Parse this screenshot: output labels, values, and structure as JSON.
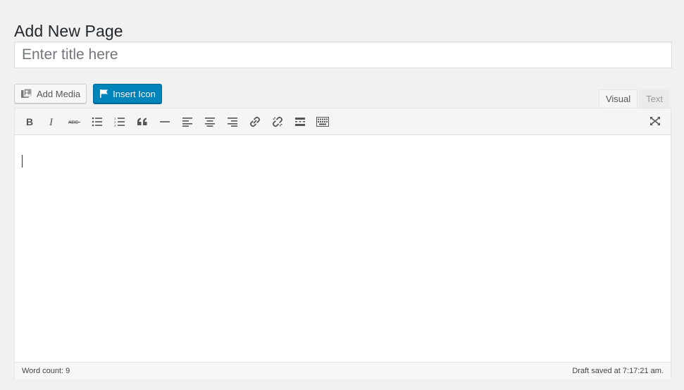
{
  "page": {
    "heading": "Add New Page"
  },
  "title_field": {
    "placeholder": "Enter title here",
    "value": ""
  },
  "media_buttons": {
    "add_media": {
      "label": "Add Media",
      "icon": "media-icon"
    },
    "insert_icon": {
      "label": "Insert Icon",
      "icon": "flag-icon"
    }
  },
  "editor_tabs": {
    "visual": "Visual",
    "text": "Text",
    "active": "Visual"
  },
  "toolbar": {
    "buttons": [
      "bold",
      "italic",
      "strikethrough",
      "bullet-list",
      "numbered-list",
      "blockquote",
      "horizontal-rule",
      "align-left",
      "align-center",
      "align-right",
      "insert-link",
      "remove-link",
      "read-more",
      "toolbar-toggle"
    ],
    "right": [
      "fullscreen"
    ]
  },
  "editor": {
    "content": ""
  },
  "status": {
    "word_count": "Word count: 9",
    "draft_saved": "Draft saved at 7:17:21 am."
  },
  "colors": {
    "primary": "#0085ba",
    "background": "#f1f1f1"
  }
}
